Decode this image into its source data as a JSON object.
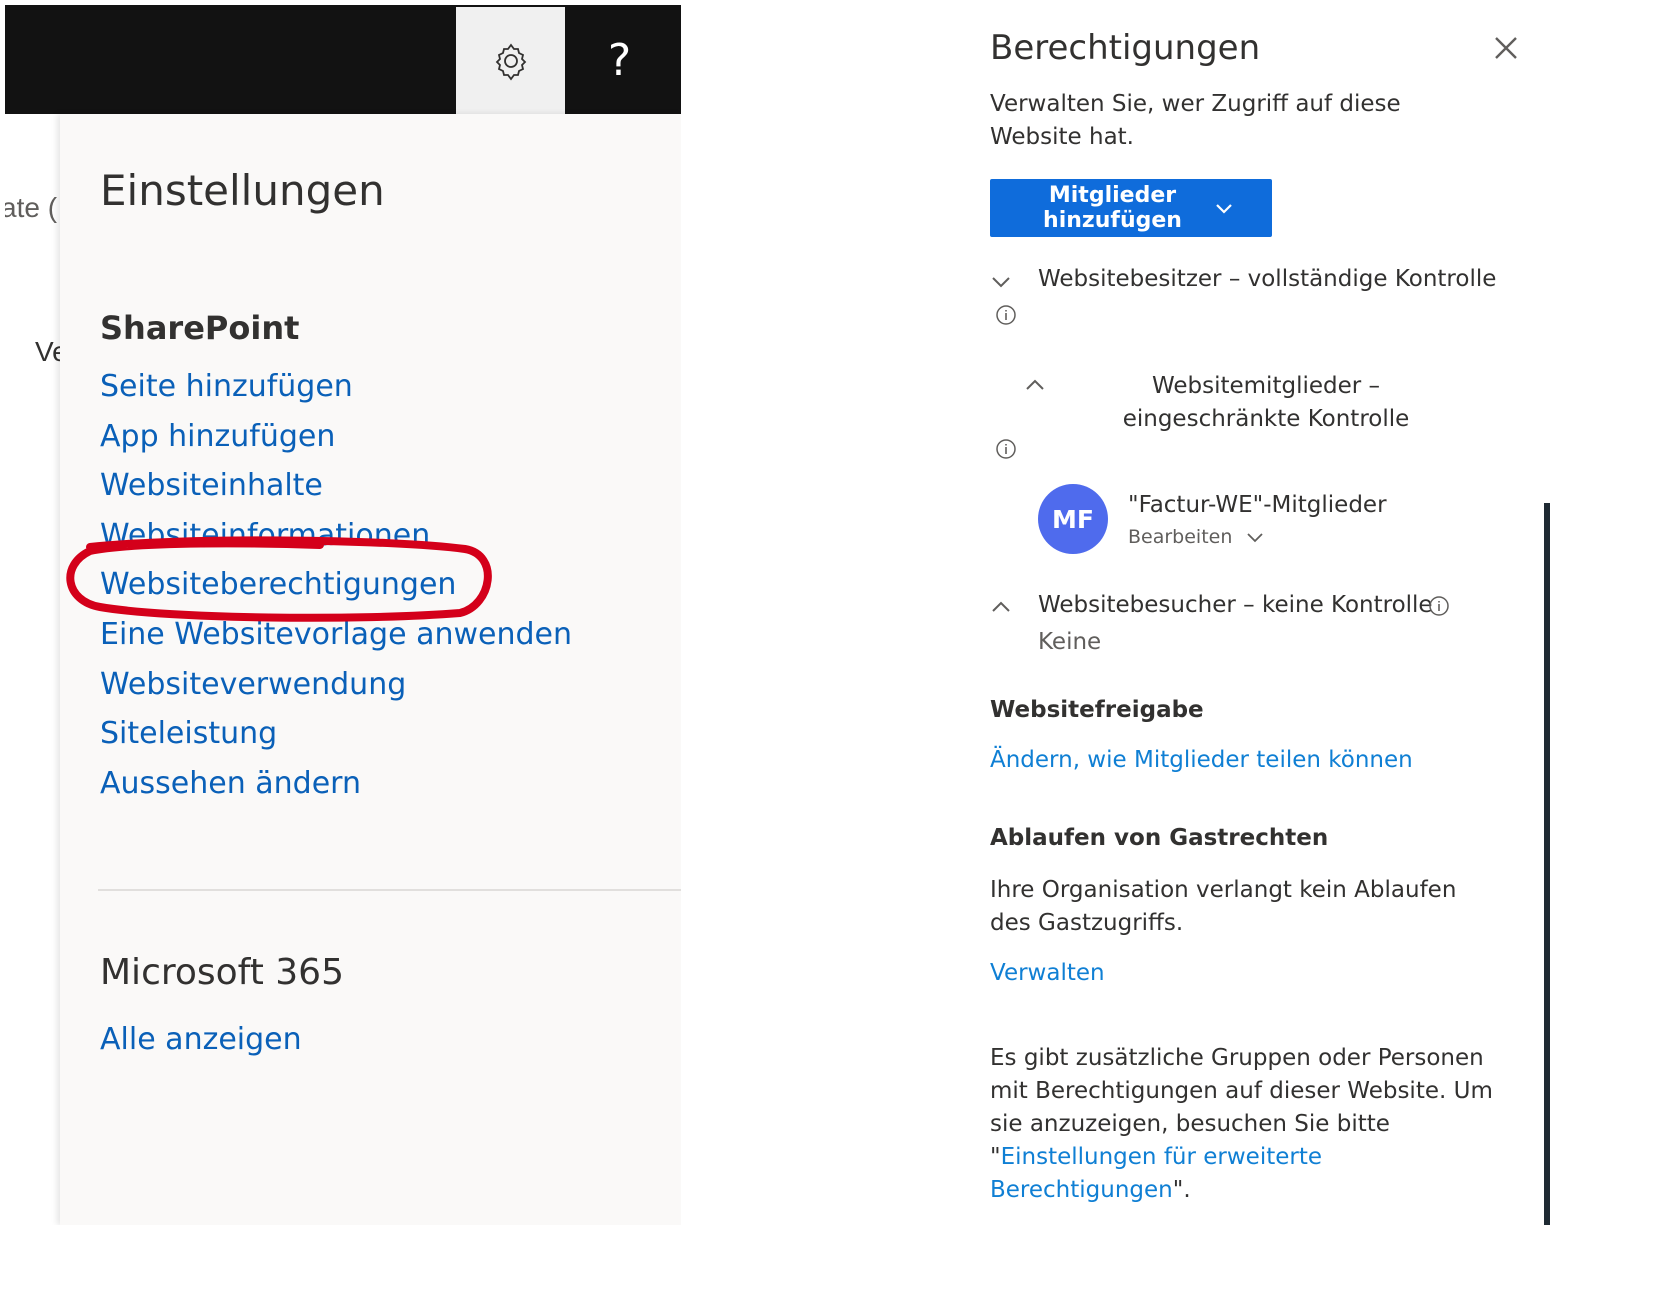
{
  "topbar": {
    "help_label": "?"
  },
  "background": {
    "fragment_1": "ate (",
    "fragment_2": "Ve"
  },
  "settings": {
    "title": "Einstellungen",
    "sharepoint_heading": "SharePoint",
    "links": [
      "Seite hinzufügen",
      "App hinzufügen",
      "Websiteinhalte",
      "Websiteinformationen",
      "Websiteberechtigungen",
      "Eine Websitevorlage anwenden",
      "Websiteverwendung",
      "Siteleistung",
      "Aussehen ändern"
    ],
    "m365_heading": "Microsoft 365",
    "m365_link": "Alle anzeigen"
  },
  "permissions": {
    "title": "Berechtigungen",
    "description": "Verwalten Sie, wer Zugriff auf diese Website hat.",
    "add_members_button": "Mitglieder\nhinzufügen",
    "groups": {
      "owners": "Websitebesitzer – vollständige Kontrolle",
      "members": "Websitemitglieder – eingeschränkte Kontrolle",
      "visitors": "Websitebesucher – keine Kontrolle",
      "visitors_value": "Keine"
    },
    "member": {
      "initials": "MF",
      "name": "\"Factur-WE\"-Mitglieder",
      "role": "Bearbeiten"
    },
    "sharing": {
      "heading": "Websitefreigabe",
      "link": "Ändern, wie Mitglieder teilen können"
    },
    "guest_expiration": {
      "heading": "Ablaufen von Gastrechten",
      "text": "Ihre Organisation verlangt kein Ablaufen des Gastzugriffs.",
      "link": "Verwalten"
    },
    "footer": {
      "text_before": "Es gibt zusätzliche Gruppen oder Personen mit Berechtigungen auf dieser Website. Um sie anzuzeigen, besuchen Sie bitte \"",
      "link": "Einstellungen für erweiterte Berechtigungen",
      "text_after": "\"."
    }
  },
  "colors": {
    "link_blue": "#0a60b8",
    "button_blue": "#0f6cdb",
    "avatar_blue": "#4f6bed",
    "annotation_red": "#d4001a"
  }
}
